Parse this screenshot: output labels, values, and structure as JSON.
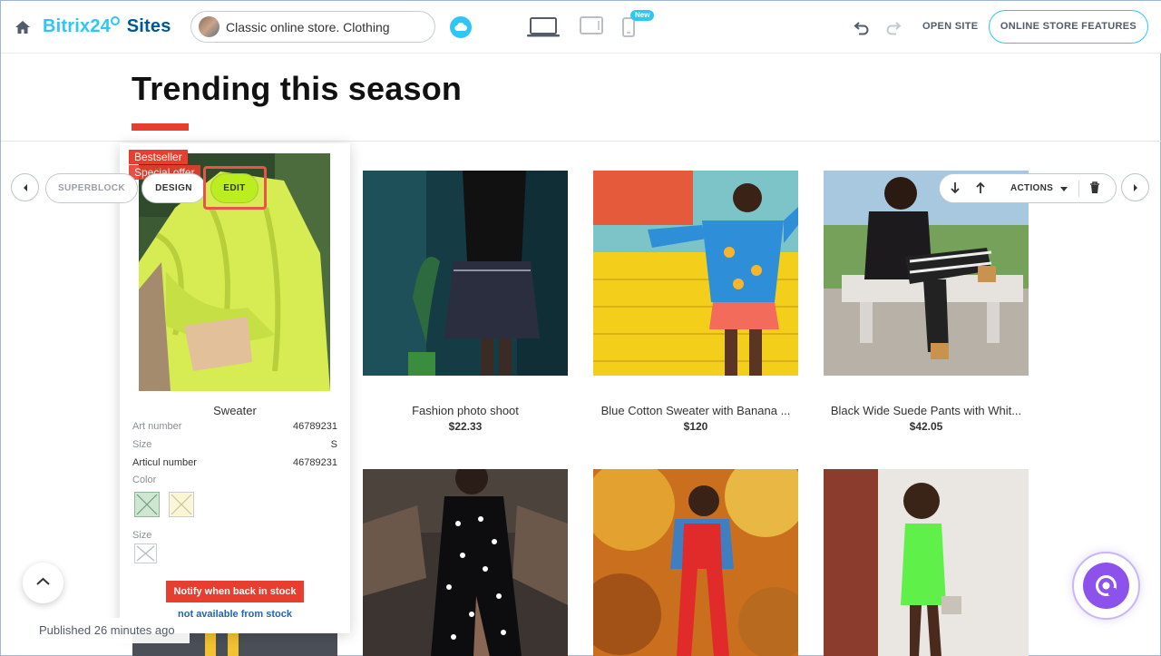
{
  "header": {
    "logo_part1": "Bitrix24",
    "logo_part2": "Sites",
    "site_name": "Classic online store. Clothing",
    "new_badge": "New",
    "open_site_label": "OPEN SITE",
    "features_label": "ONLINE STORE FEATURES",
    "accent_color": "#2fc6f6"
  },
  "section": {
    "title": "Trending this season",
    "underline_color": "#e73e2f"
  },
  "block_toolbar": {
    "superblock_label": "SUPERBLOCK",
    "design_label": "DESIGN",
    "edit_label": "EDIT",
    "actions_label": "ACTIONS"
  },
  "featured_product": {
    "badges": [
      "Bestseller",
      "Special offer"
    ],
    "name": "Sweater",
    "specs": [
      {
        "key": "Art number",
        "value": "46789231"
      },
      {
        "key": "Size",
        "value": "S"
      },
      {
        "key": "Articul number",
        "value": "46789231"
      }
    ],
    "color_label": "Color",
    "size_label": "Size",
    "notify_label": "Notify when back in stock",
    "not_available_label": "not available from stock"
  },
  "products": [
    {
      "title": "Fashion photo shoot",
      "price": "$22.33"
    },
    {
      "title": "Blue Cotton Sweater with Banana ...",
      "price": "$120"
    },
    {
      "title": "Black Wide Suede Pants with Whit...",
      "price": "$42.05"
    }
  ],
  "footer": {
    "published_text": "Published 26 minutes ago"
  }
}
